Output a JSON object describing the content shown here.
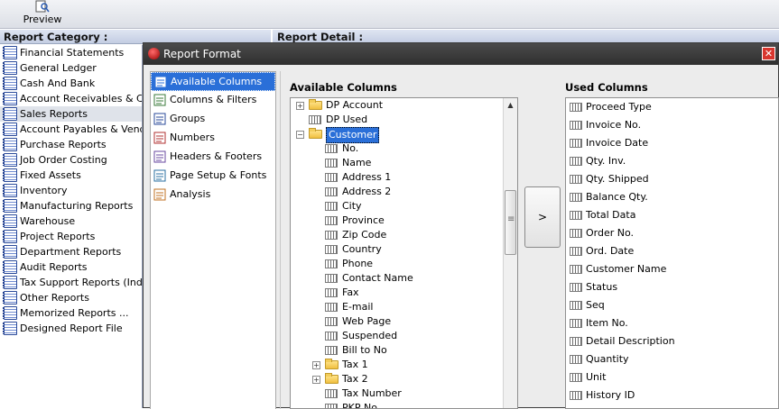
{
  "toolbar": {
    "preview_label": "Preview"
  },
  "headers": {
    "category": "Report Category :",
    "detail": "Report Detail :"
  },
  "categories": [
    "Financial Statements",
    "General Ledger",
    "Cash And Bank",
    "Account Receivables & Customers",
    "Sales Reports",
    "Account Payables & Vendors",
    "Purchase Reports",
    "Job Order Costing",
    "Fixed Assets",
    "Inventory",
    "Manufacturing Reports",
    "Warehouse",
    "Project Reports",
    "Department Reports",
    "Audit Reports",
    "Tax Support Reports (Indonesia)",
    "Other Reports",
    "Memorized Reports ...",
    "Designed Report File"
  ],
  "selected_category": "Sales Reports",
  "dialog": {
    "title": "Report Format",
    "close_symbol": "✕",
    "nav": [
      "Available Columns",
      "Columns & Filters",
      "Groups",
      "Numbers",
      "Headers & Footers",
      "Page Setup & Fonts",
      "Analysis"
    ],
    "nav_icons": [
      "columns-icon",
      "filter-icon",
      "groups-icon",
      "numbers-icon",
      "headers-icon",
      "page-setup-icon",
      "analysis-icon"
    ],
    "selected_nav": "Available Columns",
    "available_title": "Available Columns",
    "used_title": "Used Columns",
    "move_button_label": ">",
    "tree": {
      "top": [
        {
          "label": "DP Account",
          "type": "folder",
          "expandable": true
        },
        {
          "label": "DP Used",
          "type": "column"
        },
        {
          "label": "Customer",
          "type": "folder",
          "expanded": true,
          "selected": true
        }
      ],
      "customer_children": [
        {
          "label": "No.",
          "type": "column"
        },
        {
          "label": "Name",
          "type": "column"
        },
        {
          "label": "Address 1",
          "type": "column"
        },
        {
          "label": "Address 2",
          "type": "column"
        },
        {
          "label": "City",
          "type": "column"
        },
        {
          "label": "Province",
          "type": "column"
        },
        {
          "label": "Zip Code",
          "type": "column"
        },
        {
          "label": "Country",
          "type": "column"
        },
        {
          "label": "Phone",
          "type": "column"
        },
        {
          "label": "Contact Name",
          "type": "column"
        },
        {
          "label": "Fax",
          "type": "column"
        },
        {
          "label": "E-mail",
          "type": "column"
        },
        {
          "label": "Web Page",
          "type": "column"
        },
        {
          "label": "Suspended",
          "type": "column"
        },
        {
          "label": "Bill to No",
          "type": "column"
        },
        {
          "label": "Tax 1",
          "type": "folder",
          "expandable": true
        },
        {
          "label": "Tax 2",
          "type": "folder",
          "expandable": true
        },
        {
          "label": "Tax Number",
          "type": "column"
        },
        {
          "label": "PKP No.",
          "type": "column"
        }
      ]
    },
    "used_columns": [
      "Proceed Type",
      "Invoice No.",
      "Invoice Date",
      "Qty. Inv.",
      "Qty. Shipped",
      "Balance Qty.",
      "Total Data",
      "Order No.",
      "Ord. Date",
      "Customer Name",
      "Status",
      "Seq",
      "Item No.",
      "Detail Description",
      "Quantity",
      "Unit",
      "History ID"
    ]
  },
  "colors": {
    "selection": "#2a6fd8",
    "title_bar": "#3a3a3a",
    "close": "#d8362e"
  }
}
